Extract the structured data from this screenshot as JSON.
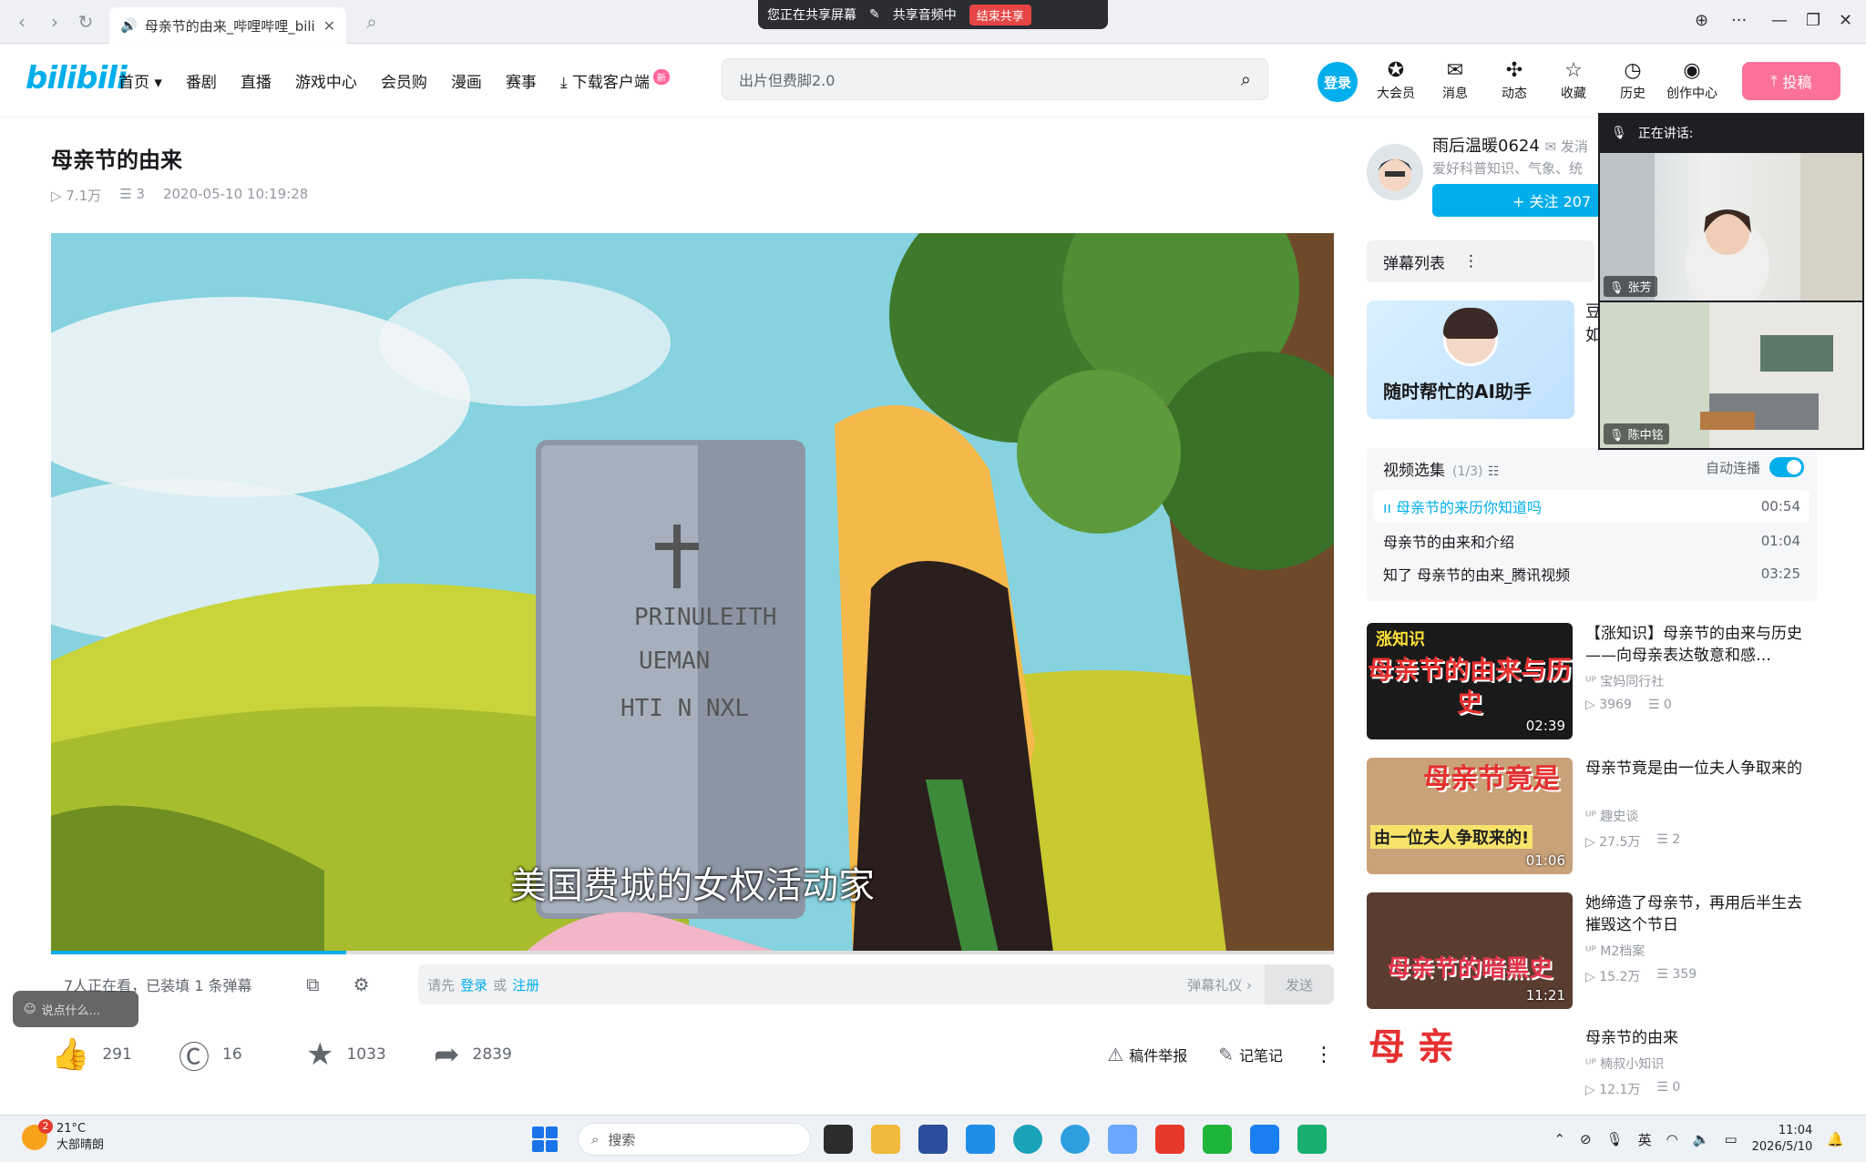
{
  "browser": {
    "tab_title": "母亲节的由来_哔哩哔哩_bilibili",
    "share_status": "您正在共享屏幕",
    "share_audio": "共享音频中",
    "end_share": "结束共享"
  },
  "header": {
    "logo": "bilibili",
    "nav": [
      "首页",
      "番剧",
      "直播",
      "游戏中心",
      "会员购",
      "漫画",
      "赛事",
      "下载客户端"
    ],
    "nav_new_badge": "新",
    "search_placeholder": "出片但费脚2.0",
    "login": "登录",
    "icons": [
      "大会员",
      "消息",
      "动态",
      "收藏",
      "历史",
      "创作中心"
    ],
    "upload": "投稿"
  },
  "video": {
    "title": "母亲节的由来",
    "views": "7.1万",
    "danmaku": "3",
    "date": "2020-05-10 10:19:28",
    "subtitle": "美国费城的女权活动家",
    "progress_fraction": 0.23
  },
  "danmaku_bar": {
    "watching": "7人正在看，已装填 1 条弹幕",
    "prompt_prefix": "请先",
    "login": "登录",
    "or": "或",
    "register": "注册",
    "etiquette": "弹幕礼仪 ›",
    "send": "发送"
  },
  "say_bubble": "说点什么...",
  "toolbar": {
    "like": "291",
    "coin": "16",
    "fav": "1033",
    "share": "2839",
    "report": "稿件举报",
    "notes": "记笔记"
  },
  "uploader": {
    "name": "雨后温暖0624",
    "msg": "发消",
    "desc": "爱好科普知识、气象、统",
    "follow": "+ 关注 207"
  },
  "danmaku_list": {
    "label": "弹幕列表"
  },
  "ai_banner": {
    "text": "随时帮忙的AI助手",
    "side": "豆",
    "side2": "如"
  },
  "episodes": {
    "label": "视频选集",
    "count": "(1/3)",
    "auto": "自动连播",
    "items": [
      {
        "title": "母亲节的来历你知道吗",
        "dur": "00:54"
      },
      {
        "title": "母亲节的由来和介绍",
        "dur": "01:04"
      },
      {
        "title": "知了 母亲节的由来_腾讯视频",
        "dur": "03:25"
      }
    ]
  },
  "recommendations": [
    {
      "title": "【涨知识】母亲节的由来与历史——向母亲表达敬意和感…",
      "up": "宝妈同行社",
      "views": "3969",
      "dm": "0",
      "dur": "02:39",
      "thumb_text": "母亲节的由来与历史",
      "tag": "涨知识"
    },
    {
      "title": "母亲节竟是由一位夫人争取来的",
      "up": "趣史谈",
      "views": "27.5万",
      "dm": "2",
      "dur": "01:06",
      "thumb_text": "母亲节竟是",
      "tag": "由一位夫人争取来的!"
    },
    {
      "title": "她缔造了母亲节，再用后半生去摧毁这个节日",
      "up": "M2档案",
      "views": "15.2万",
      "dm": "359",
      "dur": "11:21",
      "thumb_text": "母亲节的暗黑史",
      "tag": ""
    },
    {
      "title": "母亲节的由来",
      "up": "楠叔小知识",
      "views": "12.1万",
      "dm": "0",
      "dur": "",
      "thumb_text": "母 亲",
      "tag": ""
    }
  ],
  "meeting": {
    "speaking": "正在讲话:",
    "person1": "张芳",
    "person2": "陈中铭"
  },
  "taskbar": {
    "temp": "21°C",
    "weather": "大部晴朗",
    "weather_badge": "2",
    "search": "搜索",
    "ime": "英",
    "time": "11:04",
    "date": "2026/5/10"
  },
  "colors": {
    "accent": "#00aeec",
    "pink": "#fb7299"
  }
}
